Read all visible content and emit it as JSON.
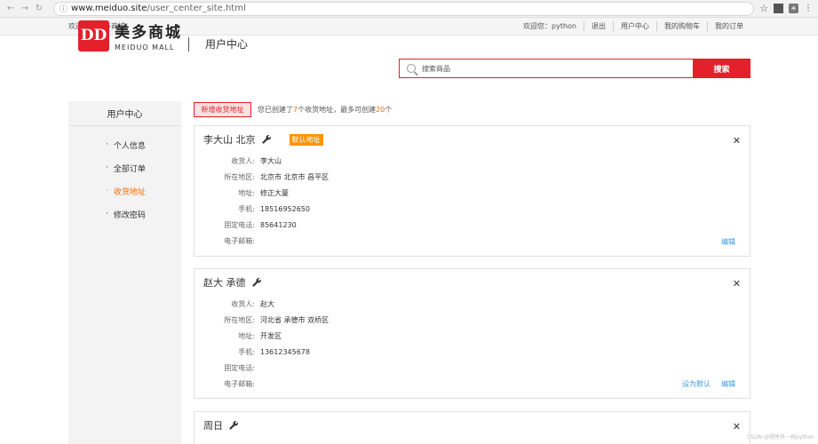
{
  "browser": {
    "url_host": "www.meiduo.site",
    "url_path": "/user_center_site.html"
  },
  "topbar": {
    "welcome": "欢迎来到美多商城!",
    "links": [
      "欢迎您：python",
      "退出",
      "用户中心",
      "我的购物车",
      "我的订单"
    ]
  },
  "header": {
    "logo_mark": "DD",
    "logo_cn": "美多商城",
    "logo_en": "MEIDUO MALL",
    "title": "用户中心",
    "search_placeholder": "搜索商品",
    "search_button": "搜索"
  },
  "sidebar": {
    "title": "用户中心",
    "items": [
      {
        "label": "个人信息"
      },
      {
        "label": "全部订单"
      },
      {
        "label": "收货地址"
      },
      {
        "label": "修改密码"
      }
    ]
  },
  "main": {
    "add_button": "新增收货地址",
    "info_pre": "您已创建了",
    "info_count": "7",
    "info_mid": "个收货地址，最多可创建",
    "info_max": "20",
    "info_post": "个"
  },
  "labels": {
    "receiver": "收货人:",
    "region": "所在地区:",
    "address": "地址:",
    "mobile": "手机:",
    "tel": "固定电话:",
    "email": "电子邮箱:"
  },
  "addresses": [
    {
      "title": "李大山 北京",
      "default_badge": "默认地址",
      "receiver": "李大山",
      "region": "北京市 北京市 昌平区",
      "address": "修正大厦",
      "mobile": "18516952650",
      "tel": "85641230",
      "email": "",
      "edit": "编辑"
    },
    {
      "title": "赵大 承德",
      "receiver": "赵大",
      "region": "河北省 承德市 双桥区",
      "address": "开发区",
      "mobile": "13612345678",
      "tel": "",
      "email": "",
      "set_default": "设为默认",
      "edit": "编辑"
    },
    {
      "title": "周日"
    }
  ],
  "watermark": "CSDN @程序员一碗python"
}
